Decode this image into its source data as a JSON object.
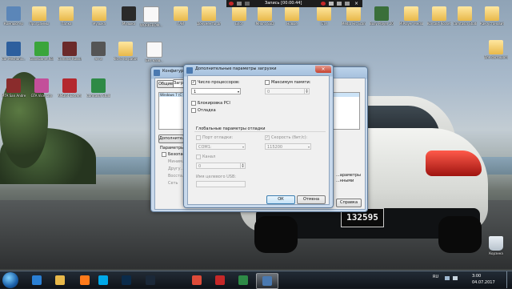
{
  "desktop": {
    "icons": [
      {
        "label": "Компьютер",
        "kind": "computer",
        "color": "#5b86b8"
      },
      {
        "label": "Программы",
        "kind": "folder",
        "color": "#e8b84a"
      },
      {
        "label": "Папка",
        "kind": "folder",
        "color": "#e8b84a"
      },
      {
        "label": "Музыка",
        "kind": "folder",
        "color": "#e8b84a"
      },
      {
        "label": "Музыка",
        "kind": "app",
        "color": "#2a2a2a"
      },
      {
        "label": "WORKFROM...",
        "kind": "doc",
        "color": "#f2f2f2"
      },
      {
        "label": "ГАИ",
        "kind": "folder",
        "color": "#e8b84a"
      },
      {
        "label": "Документы для фотошопа",
        "kind": "folder",
        "color": "#e8b84a"
      },
      {
        "label": "Блог",
        "kind": "folder",
        "color": "#e8b84a"
      },
      {
        "label": "Много SSD",
        "kind": "folder",
        "color": "#e8b84a"
      },
      {
        "label": "Новые",
        "kind": "folder",
        "color": "#e8b84a"
      },
      {
        "label": "GTA",
        "kind": "folder",
        "color": "#e8b84a"
      },
      {
        "label": "Media Hit ScanShell",
        "kind": "folder",
        "color": "#e8b84a"
      },
      {
        "label": "Busy Player 2017",
        "kind": "app",
        "color": "#3a6f3a"
      },
      {
        "label": "MiPlayer Media",
        "kind": "folder",
        "color": "#e8b84a"
      },
      {
        "label": "Kontakt Rocket Arc...",
        "kind": "folder",
        "color": "#e8b84a"
      },
      {
        "label": "Camtasia Studio 8",
        "kind": "folder",
        "color": "#e8b84a"
      },
      {
        "label": "Как установить...",
        "kind": "folder",
        "color": "#e8b84a"
      }
    ],
    "icons_row2": [
      {
        "label": "Car Mechanic...",
        "kind": "app",
        "color": "#2d5f9e"
      },
      {
        "label": "GoodGame RolePlay",
        "kind": "app",
        "color": "#3aa53a"
      },
      {
        "label": "Criminal Russia RP",
        "kind": "app",
        "color": "#6b2a2a"
      },
      {
        "label": "ягга",
        "kind": "app",
        "color": "#555555"
      },
      {
        "label": "Фото на рабочий",
        "kind": "folder",
        "color": "#e8b84a"
      },
      {
        "label": "Без назв...",
        "kind": "doc",
        "color": "#f2f2f2"
      },
      {
        "label": "Для фотошопа",
        "kind": "folder",
        "color": "#e8b84a"
      }
    ],
    "icons_row3": [
      {
        "label": "MTA San Andreas 1.5",
        "kind": "app",
        "color": "#8a2c2c"
      },
      {
        "label": "GTA Vice City",
        "kind": "app",
        "color": "#c34f9a"
      },
      {
        "label": "AMD64 Extreme",
        "kind": "app",
        "color": "#b4282e"
      },
      {
        "label": "Camtasia Studio 8",
        "kind": "app",
        "color": "#2e8a46"
      }
    ],
    "recycle_bin": "Корзина"
  },
  "recorder": {
    "title": "Запись [00:00:44]"
  },
  "msconfig": {
    "title": "Конфигура...",
    "tabs": [
      "Общие",
      "Загрузка"
    ],
    "list_item": "Windows 7 (C",
    "advanced_button": "Дополнительн...",
    "params_label": "Параметры",
    "safe_boot_label": "Безопасн...",
    "safe_options": [
      "Миним...",
      "Другу...",
      "Восста...",
      "Сеть"
    ],
    "apply_button": "Справка",
    "right_label_1": "...ыми",
    "right_label_2": "...нения",
    "side_labels": [
      "...араметры",
      "...нными"
    ]
  },
  "advanced": {
    "title": "Дополнительные параметры загрузки",
    "num_processors_label": "Число процессоров:",
    "num_processors_checked": true,
    "num_processors_value": "1",
    "max_memory_label": "Максимум памяти:",
    "max_memory_checked": false,
    "max_memory_value": "0",
    "pci_lock_label": "Блокировка PCI",
    "debug_label": "Отладка",
    "global_debug_title": "Глобальные параметры отладки",
    "debug_port_label": "Порт отладки:",
    "debug_port_value": "COM1:",
    "baud_rate_label": "Скорость (бит/с):",
    "baud_rate_value": "115200",
    "channel_label": "Канал",
    "channel_value": "0",
    "usb_target_label": "Имя целевого USB:",
    "usb_target_value": "",
    "ok_button": "ОК",
    "cancel_button": "Отмена"
  },
  "car": {
    "plate_number": "132595",
    "plate_region": "73\nRUS"
  },
  "taskbar": {
    "apps": [
      {
        "name": "ie-icon",
        "color": "#2a7fd4"
      },
      {
        "name": "explorer-icon",
        "color": "#e8b84a"
      },
      {
        "name": "media-player-icon",
        "color": "#ff7a1a"
      },
      {
        "name": "skype-icon",
        "color": "#00a8e8"
      },
      {
        "name": "photoshop-icon",
        "color": "#0b2b4a"
      },
      {
        "name": "steam-icon",
        "color": "#1b2838"
      },
      {
        "name": "chrome-icon",
        "color": "#dd4b39"
      },
      {
        "name": "recorder-icon",
        "color": "#c62828"
      },
      {
        "name": "camtasia-icon",
        "color": "#2e8a46"
      },
      {
        "name": "msconfig-icon",
        "color": "#4a79b0"
      }
    ],
    "lang": "RU",
    "time": "3:00",
    "date": "04.07.2017"
  }
}
